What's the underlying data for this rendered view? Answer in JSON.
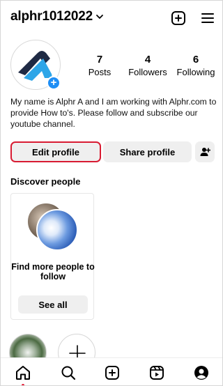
{
  "header": {
    "username": "alphr1012022"
  },
  "profile": {
    "stats": [
      {
        "value": "7",
        "label": "Posts"
      },
      {
        "value": "4",
        "label": "Followers"
      },
      {
        "value": "6",
        "label": "Following"
      }
    ],
    "bio": "My name is Alphr A and I am working with Alphr.com to provide How to's. Please follow and subscribe our youtube channel."
  },
  "actions": {
    "edit_label": "Edit profile",
    "share_label": "Share profile"
  },
  "discover": {
    "title": "Discover people",
    "card_text": "Find more people to follow",
    "card_button": "See all"
  },
  "icons": {
    "header": [
      "chevron-down-icon",
      "plus-square-icon",
      "menu-icon"
    ],
    "avatar_badge": "plus-icon",
    "discover": "add-user-icon",
    "nav": [
      "home-icon",
      "search-icon",
      "create-icon",
      "reels-icon",
      "profile-icon"
    ]
  },
  "colors": {
    "accent_blue": "#1e8ef5",
    "highlight_red": "#d81b32",
    "button_bg": "#efefef",
    "logo_dark": "#1f2a44",
    "logo_light_blue": "#2ea6e8"
  }
}
